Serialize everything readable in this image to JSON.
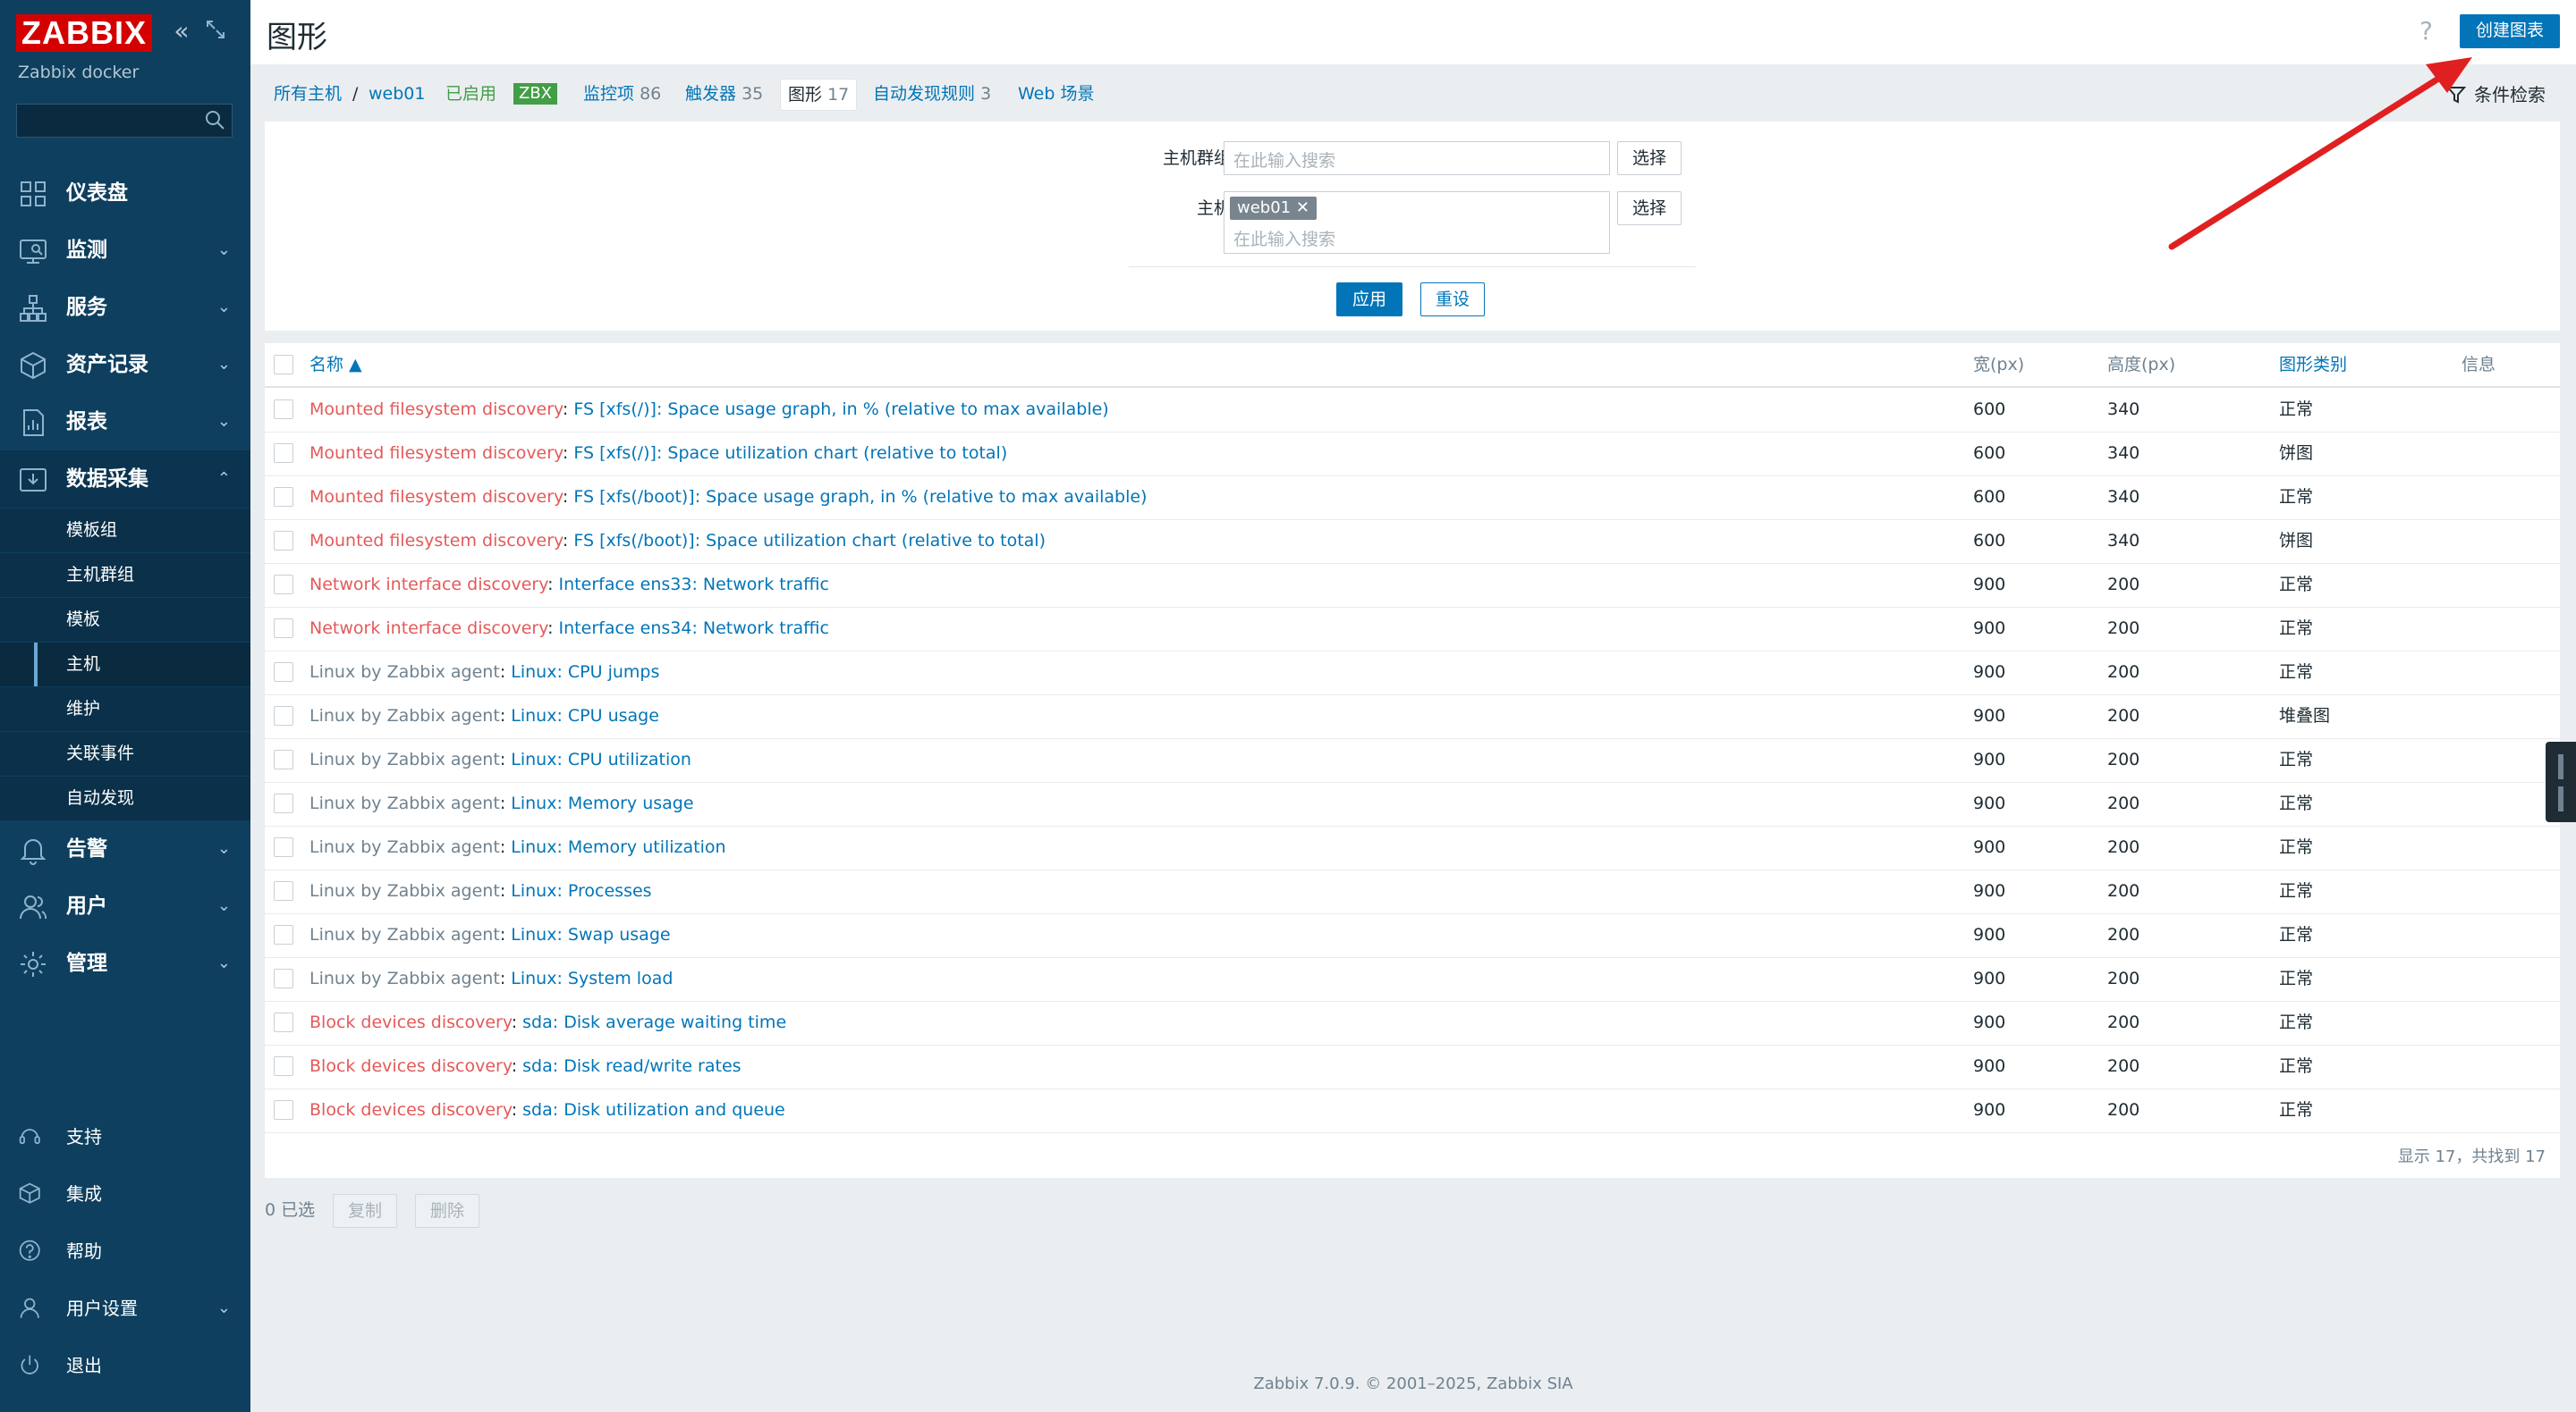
{
  "sidebar": {
    "logo": "ZABBIX",
    "subtitle": "Zabbix docker",
    "search_value": "",
    "menu": [
      {
        "label": "仪表盘",
        "icon": "dashboard-icon",
        "chevron": ""
      },
      {
        "label": "监测",
        "icon": "monitoring-icon",
        "chevron": "⌄"
      },
      {
        "label": "服务",
        "icon": "services-icon",
        "chevron": "⌄"
      },
      {
        "label": "资产记录",
        "icon": "inventory-icon",
        "chevron": "⌄"
      },
      {
        "label": "报表",
        "icon": "reports-icon",
        "chevron": "⌄"
      },
      {
        "label": "数据采集",
        "icon": "data-collection-icon",
        "chevron": "⌃"
      }
    ],
    "submenu": [
      "模板组",
      "主机群组",
      "模板",
      "主机",
      "维护",
      "关联事件",
      "自动发现"
    ],
    "menu2": [
      {
        "label": "告警",
        "icon": "alerts-icon",
        "chevron": "⌄"
      },
      {
        "label": "用户",
        "icon": "users-icon",
        "chevron": "⌄"
      },
      {
        "label": "管理",
        "icon": "administration-icon",
        "chevron": "⌄"
      }
    ],
    "bottom": [
      {
        "label": "支持",
        "icon": "support-icon",
        "chevron": ""
      },
      {
        "label": "集成",
        "icon": "integrations-icon",
        "chevron": ""
      },
      {
        "label": "帮助",
        "icon": "help-icon",
        "chevron": ""
      },
      {
        "label": "用户设置",
        "icon": "user-settings-icon",
        "chevron": "⌄"
      },
      {
        "label": "退出",
        "icon": "sign-out-icon",
        "chevron": ""
      }
    ]
  },
  "header": {
    "title": "图形",
    "help": "?",
    "create_button": "创建图表"
  },
  "tabs": {
    "all_hosts": "所有主机",
    "slash": "/",
    "host": "web01",
    "enabled": "已启用",
    "zbx": "ZBX",
    "items_label": "监控项",
    "items_count": "86",
    "triggers_label": "触发器",
    "triggers_count": "35",
    "graphs_label": "图形",
    "graphs_count": "17",
    "discovery_label": "自动发现规则",
    "discovery_count": "3",
    "web_label": "Web 场景",
    "filter_label": "条件检索"
  },
  "filter": {
    "hostgroup_label": "主机群组",
    "hostgroup_placeholder": "在此输入搜索",
    "host_label": "主机",
    "host_tag": "web01",
    "host_placeholder": "在此输入搜索",
    "select_button": "选择",
    "apply_button": "应用",
    "reset_button": "重设"
  },
  "table": {
    "columns": {
      "name": "名称 ▲",
      "width": "宽(px)",
      "height": "高度(px)",
      "type": "图形类别",
      "info": "信息"
    },
    "rows": [
      {
        "prefix": "Mounted filesystem discovery",
        "prefix_style": "red",
        "name": "FS [xfs(/)]: Space usage graph, in % (relative to max available)",
        "width": "600",
        "height": "340",
        "type": "正常"
      },
      {
        "prefix": "Mounted filesystem discovery",
        "prefix_style": "red",
        "name": "FS [xfs(/)]: Space utilization chart (relative to total)",
        "width": "600",
        "height": "340",
        "type": "饼图"
      },
      {
        "prefix": "Mounted filesystem discovery",
        "prefix_style": "red",
        "name": "FS [xfs(/boot)]: Space usage graph, in % (relative to max available)",
        "width": "600",
        "height": "340",
        "type": "正常"
      },
      {
        "prefix": "Mounted filesystem discovery",
        "prefix_style": "red",
        "name": "FS [xfs(/boot)]: Space utilization chart (relative to total)",
        "width": "600",
        "height": "340",
        "type": "饼图"
      },
      {
        "prefix": "Network interface discovery",
        "prefix_style": "red",
        "name": "Interface ens33: Network traffic",
        "width": "900",
        "height": "200",
        "type": "正常"
      },
      {
        "prefix": "Network interface discovery",
        "prefix_style": "red",
        "name": "Interface ens34: Network traffic",
        "width": "900",
        "height": "200",
        "type": "正常"
      },
      {
        "prefix": "Linux by Zabbix agent",
        "prefix_style": "grey",
        "name": "Linux: CPU jumps",
        "width": "900",
        "height": "200",
        "type": "正常"
      },
      {
        "prefix": "Linux by Zabbix agent",
        "prefix_style": "grey",
        "name": "Linux: CPU usage",
        "width": "900",
        "height": "200",
        "type": "堆叠图"
      },
      {
        "prefix": "Linux by Zabbix agent",
        "prefix_style": "grey",
        "name": "Linux: CPU utilization",
        "width": "900",
        "height": "200",
        "type": "正常"
      },
      {
        "prefix": "Linux by Zabbix agent",
        "prefix_style": "grey",
        "name": "Linux: Memory usage",
        "width": "900",
        "height": "200",
        "type": "正常"
      },
      {
        "prefix": "Linux by Zabbix agent",
        "prefix_style": "grey",
        "name": "Linux: Memory utilization",
        "width": "900",
        "height": "200",
        "type": "正常"
      },
      {
        "prefix": "Linux by Zabbix agent",
        "prefix_style": "grey",
        "name": "Linux: Processes",
        "width": "900",
        "height": "200",
        "type": "正常"
      },
      {
        "prefix": "Linux by Zabbix agent",
        "prefix_style": "grey",
        "name": "Linux: Swap usage",
        "width": "900",
        "height": "200",
        "type": "正常"
      },
      {
        "prefix": "Linux by Zabbix agent",
        "prefix_style": "grey",
        "name": "Linux: System load",
        "width": "900",
        "height": "200",
        "type": "正常"
      },
      {
        "prefix": "Block devices discovery",
        "prefix_style": "red",
        "name": "sda: Disk average waiting time",
        "width": "900",
        "height": "200",
        "type": "正常"
      },
      {
        "prefix": "Block devices discovery",
        "prefix_style": "red",
        "name": "sda: Disk read/write rates",
        "width": "900",
        "height": "200",
        "type": "正常"
      },
      {
        "prefix": "Block devices discovery",
        "prefix_style": "red",
        "name": "sda: Disk utilization and queue",
        "width": "900",
        "height": "200",
        "type": "正常"
      }
    ],
    "footer": "显示 17，共找到 17"
  },
  "bulk": {
    "selected": "0 已选",
    "copy": "复制",
    "delete": "删除"
  },
  "footer": "Zabbix 7.0.9. © 2001–2025, Zabbix SIA",
  "annotation_color": "#e02020"
}
